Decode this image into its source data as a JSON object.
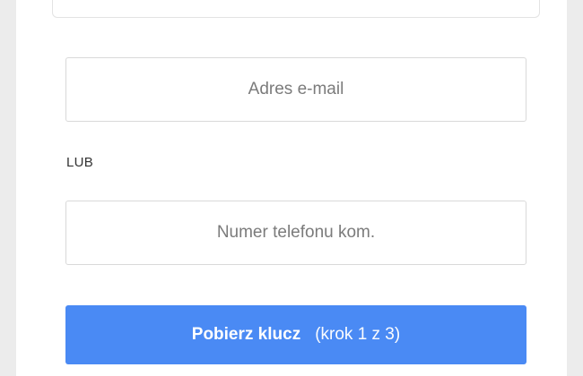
{
  "form": {
    "email_placeholder": "Adres e-mail",
    "or_label": "LUB",
    "phone_placeholder": "Numer telefonu kom.",
    "submit": {
      "label": "Pobierz klucz",
      "step": "(krok 1 z 3)"
    }
  },
  "colors": {
    "background": "#ececec",
    "panel": "#ffffff",
    "button": "#4a8af4",
    "field_border": "#d9d9d9",
    "placeholder_text": "#7b7b7b"
  }
}
